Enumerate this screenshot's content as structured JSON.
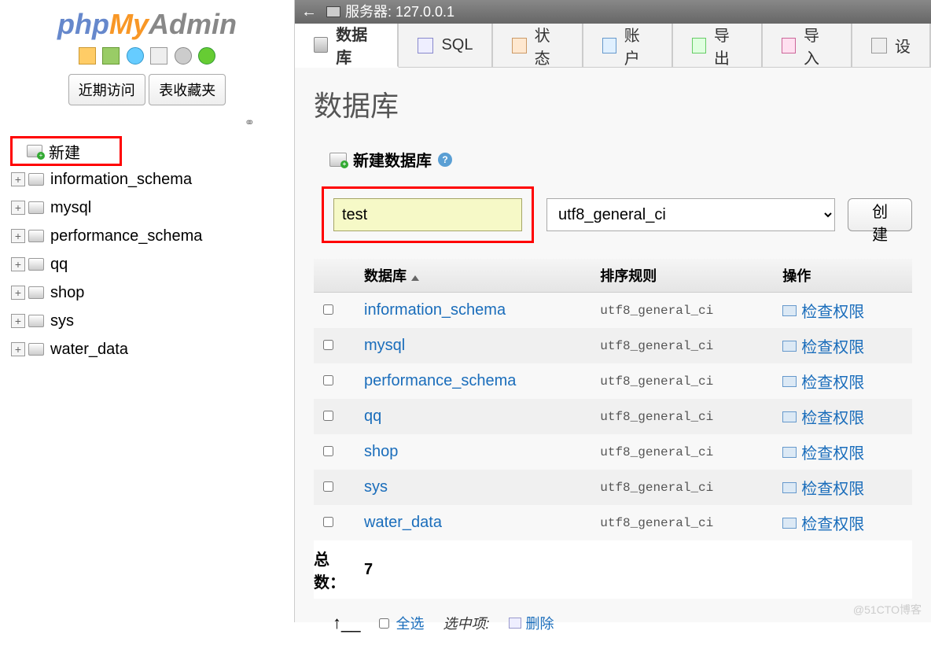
{
  "logo": {
    "php": "php",
    "my": "My",
    "admin": "Admin"
  },
  "sidebar": {
    "recent_tab": "近期访问",
    "favorites_tab": "表收藏夹",
    "new_label": "新建",
    "databases": [
      "information_schema",
      "mysql",
      "performance_schema",
      "qq",
      "shop",
      "sys",
      "water_data"
    ]
  },
  "topbar": {
    "server_label": "服务器: 127.0.0.1"
  },
  "tabs": {
    "database": "数据库",
    "sql": "SQL",
    "status": "状态",
    "accounts": "账户",
    "export": "导出",
    "import": "导入",
    "settings": "设"
  },
  "content": {
    "heading": "数据库",
    "create_heading": "新建数据库",
    "dbname_input": "test",
    "collation_selected": "utf8_general_ci",
    "create_button": "创建",
    "table": {
      "col_db": "数据库",
      "col_collation": "排序规则",
      "col_action": "操作",
      "check_priv": "检查权限",
      "rows": [
        {
          "name": "information_schema",
          "collation": "utf8_general_ci"
        },
        {
          "name": "mysql",
          "collation": "utf8_general_ci"
        },
        {
          "name": "performance_schema",
          "collation": "utf8_general_ci"
        },
        {
          "name": "qq",
          "collation": "utf8_general_ci"
        },
        {
          "name": "shop",
          "collation": "utf8_general_ci"
        },
        {
          "name": "sys",
          "collation": "utf8_general_ci"
        },
        {
          "name": "water_data",
          "collation": "utf8_general_ci"
        }
      ],
      "total_label": "总数：",
      "total_count": "7"
    },
    "footer": {
      "select_all": "全选",
      "with_selected": "选中项:",
      "delete": "删除"
    }
  },
  "watermark": "@51CTO博客"
}
